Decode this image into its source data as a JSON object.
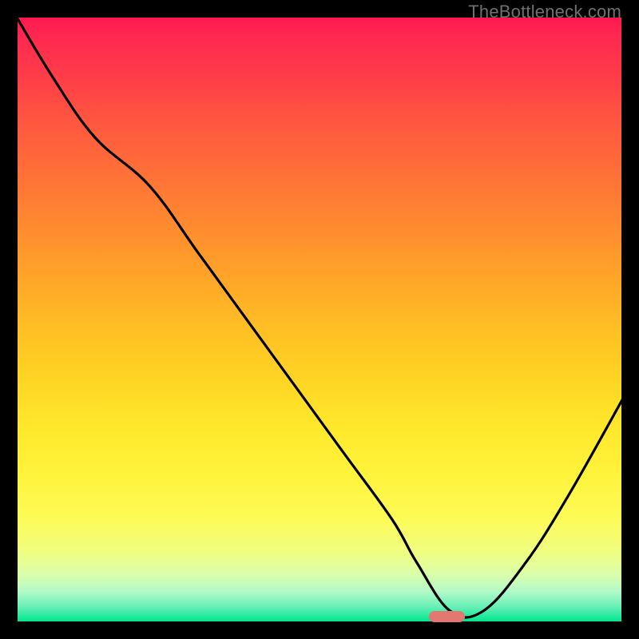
{
  "watermark": "TheBottleneck.com",
  "chart_data": {
    "type": "line",
    "x": [
      0.0,
      0.06,
      0.13,
      0.22,
      0.3,
      0.38,
      0.46,
      0.54,
      0.62,
      0.66,
      0.715,
      0.77,
      0.84,
      0.91,
      1.0
    ],
    "values": [
      100,
      90,
      80,
      72,
      61,
      50,
      39,
      28,
      17,
      10,
      2,
      2,
      10,
      21,
      37
    ],
    "title": "",
    "xlabel": "",
    "ylabel": "",
    "xlim": [
      0,
      1
    ],
    "ylim": [
      0,
      100
    ],
    "marker_x": [
      0.68,
      0.74
    ],
    "marker_y": 1
  }
}
